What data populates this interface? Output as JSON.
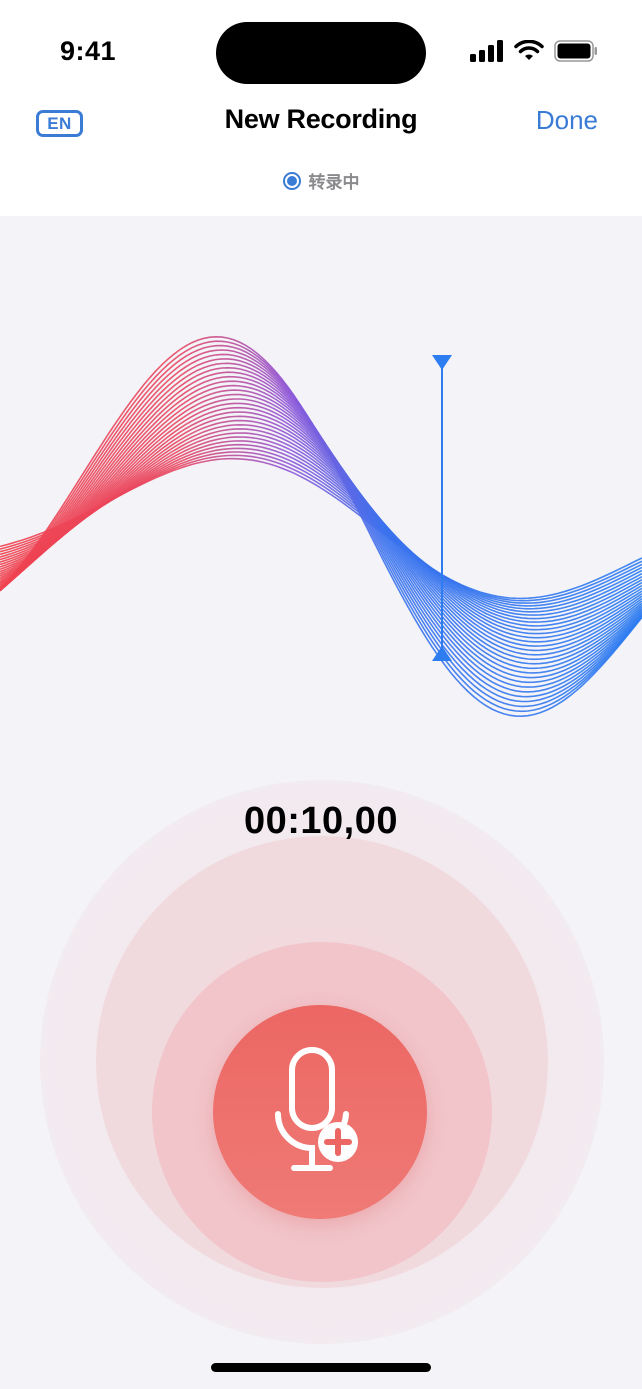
{
  "status_bar": {
    "time": "9:41",
    "icons": [
      "signal-icon",
      "wifi-icon",
      "battery-icon"
    ]
  },
  "nav": {
    "language_label": "EN",
    "title": "New Recording",
    "done_label": "Done"
  },
  "transcribe": {
    "status_text": "转录中"
  },
  "recording": {
    "elapsed_time": "00:10,00"
  },
  "colors": {
    "accent": "#3a7bd5",
    "wave_start": "#f0414e",
    "wave_end": "#2d7cf0",
    "record_button": "#ec6763"
  },
  "icons": {
    "record_button_icon": "microphone-plus-icon",
    "playhead": "playhead-marker-icon"
  }
}
